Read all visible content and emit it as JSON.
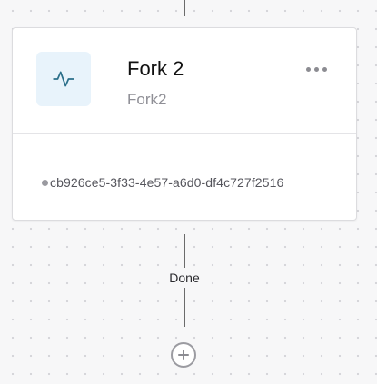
{
  "node": {
    "title": "Fork 2",
    "subtitle": "Fork2",
    "id": "cb926ce5-3f33-4e57-a6d0-df4c727f2516",
    "icon": "activity-pulse-icon",
    "icon_color": "#2b6f8a",
    "icon_background": "#e8f3fb"
  },
  "edge": {
    "label": "Done"
  },
  "actions": {
    "more_icon": "more-horizontal-icon",
    "add_icon": "plus-circle-icon"
  }
}
